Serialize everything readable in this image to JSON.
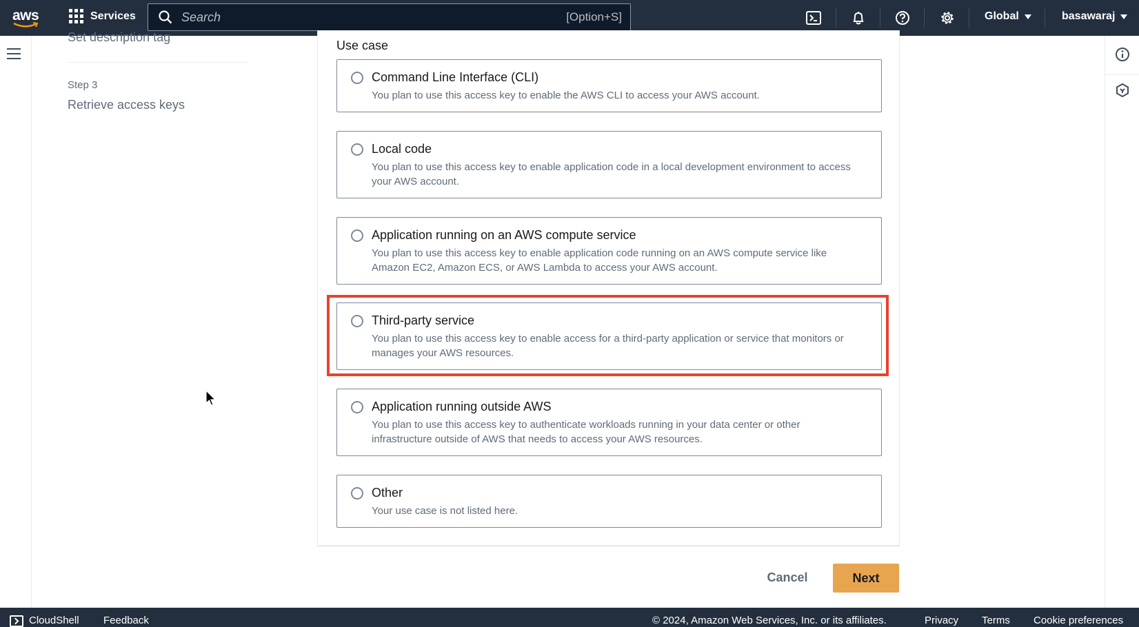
{
  "topnav": {
    "logo_text": "aws",
    "services_label": "Services",
    "search_placeholder": "Search",
    "search_shortcut": "[Option+S]",
    "icons": [
      "cloudshell-icon",
      "bell-icon",
      "help-icon",
      "gear-icon"
    ],
    "region_label": "Global",
    "user_label": "basawaraj"
  },
  "steps": {
    "previous_item": "Set description tag",
    "step3_label": "Step 3",
    "step3_title": "Retrieve access keys"
  },
  "use_case": {
    "label": "Use case",
    "options": [
      {
        "title": "Command Line Interface (CLI)",
        "description": "You plan to use this access key to enable the AWS CLI to access your AWS account."
      },
      {
        "title": "Local code",
        "description": "You plan to use this access key to enable application code in a local development environment to access your AWS account."
      },
      {
        "title": "Application running on an AWS compute service",
        "description": "You plan to use this access key to enable application code running on an AWS compute service like Amazon EC2, Amazon ECS, or AWS Lambda to access your AWS account."
      },
      {
        "title": "Third-party service",
        "description": "You plan to use this access key to enable access for a third-party application or service that monitors or manages your AWS resources."
      },
      {
        "title": "Application running outside AWS",
        "description": "You plan to use this access key to authenticate workloads running in your data center or other infrastructure outside of AWS that needs to access your AWS resources."
      },
      {
        "title": "Other",
        "description": "Your use case is not listed here."
      }
    ]
  },
  "actions": {
    "cancel_label": "Cancel",
    "next_label": "Next"
  },
  "footer": {
    "cloudshell_label": "CloudShell",
    "feedback_label": "Feedback",
    "copyright": "© 2024, Amazon Web Services, Inc. or its affiliates.",
    "privacy_label": "Privacy",
    "terms_label": "Terms",
    "cookie_label": "Cookie preferences"
  },
  "colors": {
    "nav_bg": "#232f3e",
    "primary_button": "#e8a54f",
    "highlight_border": "#e9422c"
  }
}
